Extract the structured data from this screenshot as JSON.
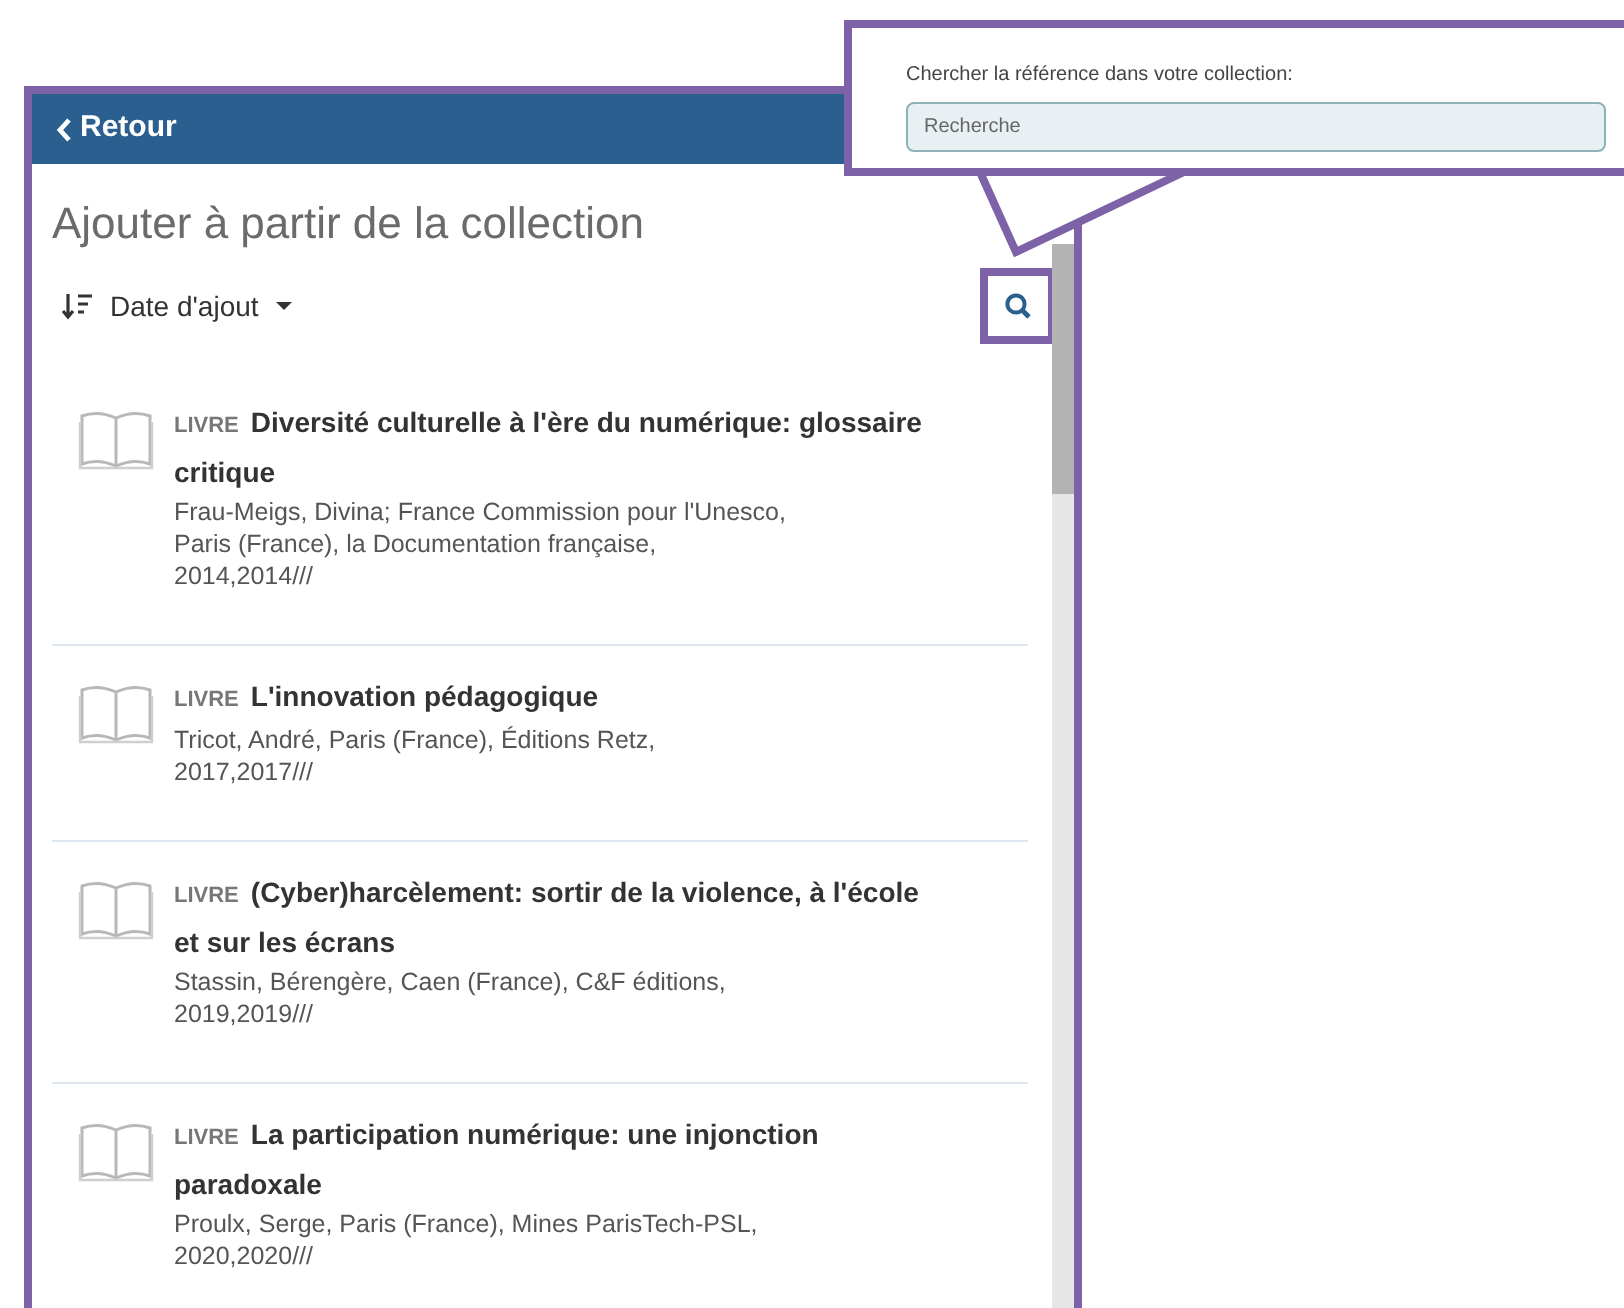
{
  "header": {
    "back_label": "Retour"
  },
  "title": "Ajouter à partir de la collection",
  "sort": {
    "label": "Date d'ajout"
  },
  "search_popup": {
    "label": "Chercher la référence dans votre collection:",
    "placeholder": "Recherche"
  },
  "items": [
    {
      "type_label": "LIVRE",
      "title": "Diversité culturelle à l'ère du numérique: glossaire critique",
      "details": [
        "Frau-Meigs, Divina; France Commission pour l'Unesco,",
        "Paris (France), la Documentation française,",
        "2014,2014///"
      ]
    },
    {
      "type_label": "LIVRE",
      "title": "L'innovation pédagogique",
      "details": [
        "Tricot, André, Paris (France), Éditions Retz,",
        "2017,2017///"
      ]
    },
    {
      "type_label": "LIVRE",
      "title": "(Cyber)harcèlement: sortir de la violence, à l'école et sur les écrans",
      "details": [
        "Stassin, Bérengère, Caen (France), C&F éditions,",
        "2019,2019///"
      ]
    },
    {
      "type_label": "LIVRE",
      "title": "La participation numérique: une injonction paradoxale",
      "details": [
        "Proulx, Serge, Paris (France), Mines ParisTech-PSL,",
        "2020,2020///"
      ]
    }
  ]
}
